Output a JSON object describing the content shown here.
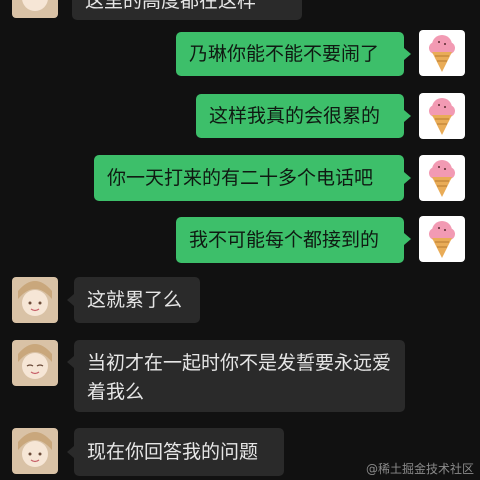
{
  "chat": {
    "partial_top_text": "这里的高度都在这样",
    "outgoing": [
      "乃琳你能不能不要闹了",
      "这样我真的会很累的",
      "你一天打来的有二十多个电话吧",
      "我不可能每个都接到的"
    ],
    "incoming": [
      "这就累了么",
      "当初才在一起时你不是发誓要永远爱着我么",
      "现在你回答我的问题"
    ]
  },
  "icons": {
    "self_avatar": "ice-cream-icon",
    "other_avatar": "anime-girl-avatar"
  },
  "watermark": "@稀土掘金技术社区",
  "colors": {
    "background": "#111111",
    "outgoing_bubble": "#3dbf6a",
    "incoming_bubble": "#2a2a2a"
  }
}
